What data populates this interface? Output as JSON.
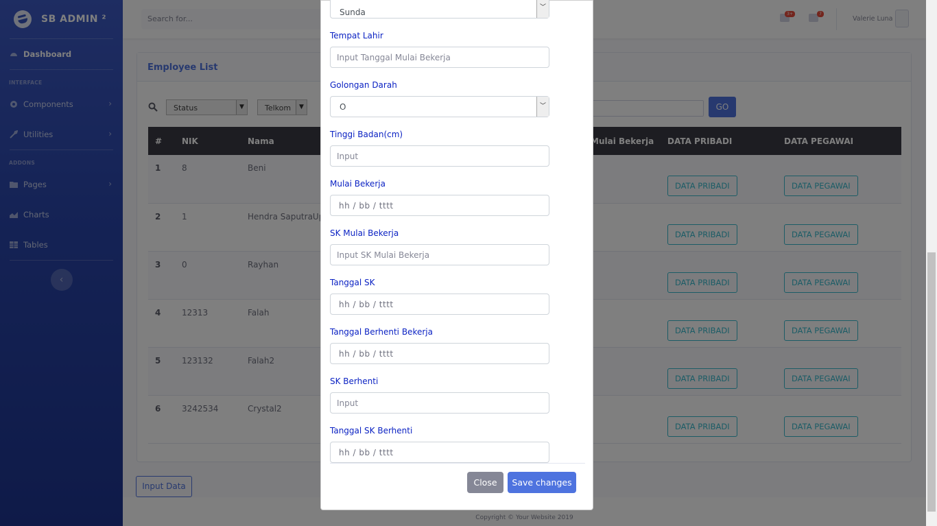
{
  "brand": {
    "name": "SB ADMIN ²"
  },
  "sidebar": {
    "dashboard": "Dashboard",
    "heading_interface": "INTERFACE",
    "components": "Components",
    "utilities": "Utilities",
    "heading_addons": "ADDONS",
    "pages": "Pages",
    "charts": "Charts",
    "tables": "Tables"
  },
  "topbar": {
    "search_placeholder": "Search for...",
    "alerts_badge": "3+",
    "messages_badge": "7",
    "user_name": "Valerie Luna"
  },
  "card": {
    "title": "Employee List",
    "filters": {
      "status": "Status",
      "company": "Telkom",
      "go": "GO"
    },
    "columns": [
      "#",
      "NIK",
      "Nama",
      "Mulai Bekerja",
      "DATA PRIBADI",
      "DATA PEGAWAI"
    ],
    "rows": [
      {
        "no": "1",
        "nik": "8",
        "nama": "Beni"
      },
      {
        "no": "2",
        "nik": "1",
        "nama": "Hendra SaputraUp"
      },
      {
        "no": "3",
        "nik": "0",
        "nama": "Rayhan"
      },
      {
        "no": "4",
        "nik": "12313",
        "nama": "Falah"
      },
      {
        "no": "5",
        "nik": "123132",
        "nama": "Falah2"
      },
      {
        "no": "6",
        "nik": "3242534",
        "nama": "Crystal2"
      }
    ],
    "btn_pribadi": "DATA PRIBADI",
    "btn_pegawai": "DATA PEGAWAI"
  },
  "input_data_button": "Input Data",
  "footer": "Copyright © Your Website 2019",
  "modal": {
    "suku_value": "Sunda",
    "tempat_lahir_label": "Tempat Lahir",
    "tempat_lahir_placeholder": "Input Tanggal Mulai Bekerja",
    "golongan_darah_label": "Golongan Darah",
    "golongan_darah_value": "O",
    "tinggi_badan_label": "Tinggi Badan(cm)",
    "tinggi_badan_placeholder": "Input",
    "mulai_bekerja_label": "Mulai Bekerja",
    "sk_mulai_bekerja_label": "SK Mulai Bekerja",
    "sk_mulai_bekerja_placeholder": "Input SK Mulai Bekerja",
    "tanggal_sk_label": "Tanggal SK",
    "tanggal_berhenti_label": "Tanggal Berhenti Bekerja",
    "sk_berhenti_label": "SK Berhenti",
    "sk_berhenti_placeholder": "Input",
    "tanggal_sk_berhenti_label": "Tanggal SK Berhenti",
    "date_placeholder": "hh / bb / tttt",
    "close": "Close",
    "save": "Save changes"
  }
}
